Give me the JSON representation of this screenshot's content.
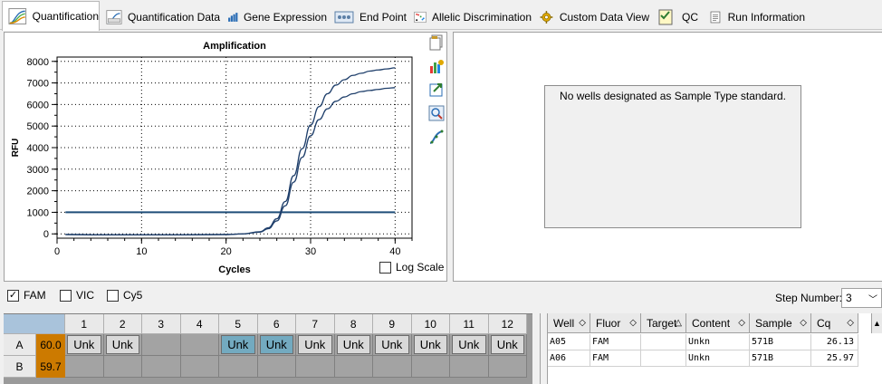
{
  "tabs": [
    {
      "label": "Quantification",
      "icon": "amplification-curve-icon",
      "active": true
    },
    {
      "label": "Quantification Data",
      "icon": "quantification-data-icon",
      "active": false
    },
    {
      "label": "Gene Expression",
      "icon": "bar-chart-icon",
      "active": false
    },
    {
      "label": "End Point",
      "icon": "end-point-icon",
      "active": false
    },
    {
      "label": "Allelic Discrimination",
      "icon": "allelic-scatter-icon",
      "active": false
    },
    {
      "label": "Custom Data View",
      "icon": "gear-icon",
      "active": false
    },
    {
      "label": "QC",
      "icon": "qc-checklist-icon",
      "active": false
    },
    {
      "label": "Run Information",
      "icon": "document-icon",
      "active": false
    }
  ],
  "chart_data": {
    "type": "line",
    "title": "Amplification",
    "xlabel": "Cycles",
    "ylabel": "RFU",
    "xlim": [
      0,
      42
    ],
    "ylim": [
      -200,
      8200
    ],
    "xticks": [
      0,
      10,
      20,
      30,
      40
    ],
    "yticks": [
      0,
      1000,
      2000,
      3000,
      4000,
      5000,
      6000,
      7000,
      8000
    ],
    "grid": true,
    "x": [
      1,
      5,
      10,
      15,
      20,
      22,
      24,
      25,
      26,
      27,
      28,
      29,
      30,
      31,
      32,
      33,
      34,
      35,
      36,
      37,
      38,
      39,
      40
    ],
    "series": [
      {
        "values": [
          -30,
          -40,
          -40,
          -40,
          -30,
          0,
          100,
          280,
          700,
          1500,
          2700,
          3950,
          5050,
          5900,
          6500,
          6900,
          7150,
          7350,
          7450,
          7550,
          7600,
          7650,
          7700
        ]
      },
      {
        "values": [
          -30,
          -40,
          -40,
          -40,
          -30,
          0,
          80,
          240,
          600,
          1300,
          2400,
          3550,
          4550,
          5300,
          5800,
          6150,
          6350,
          6500,
          6600,
          6650,
          6700,
          6750,
          6780
        ]
      }
    ],
    "threshold": 1000
  },
  "chart": {
    "log_scale_label": "Log Scale",
    "log_scale_checked": false,
    "line_color": "#1f3f6b",
    "threshold_color": "#1f4e79"
  },
  "side_tools": [
    "copy-icon",
    "chart-options-icon",
    "export-icon",
    "zoom-icon",
    "curve-tool-icon"
  ],
  "standard_panel": {
    "message": "No wells designated as Sample Type standard."
  },
  "fluors": [
    {
      "label": "FAM",
      "checked": true
    },
    {
      "label": "VIC",
      "checked": false
    },
    {
      "label": "Cy5",
      "checked": false
    }
  ],
  "step": {
    "label": "Step Number:",
    "value": "3"
  },
  "plate": {
    "columns": [
      "1",
      "2",
      "3",
      "4",
      "5",
      "6",
      "7",
      "8",
      "9",
      "10",
      "11",
      "12"
    ],
    "rows": [
      {
        "label": "A",
        "temp": "60.0",
        "wells": [
          "Unk",
          "Unk",
          "",
          "",
          "Unk",
          "Unk",
          "Unk",
          "Unk",
          "Unk",
          "Unk",
          "Unk",
          "Unk"
        ],
        "selected": [
          false,
          false,
          false,
          false,
          true,
          true,
          false,
          false,
          false,
          false,
          false,
          false
        ]
      },
      {
        "label": "B",
        "temp": "59.7",
        "wells": [
          "",
          "",
          "",
          "",
          "",
          "",
          "",
          "",
          "",
          "",
          "",
          ""
        ],
        "selected": [
          false,
          false,
          false,
          false,
          false,
          false,
          false,
          false,
          false,
          false,
          false,
          false
        ]
      }
    ],
    "temp_color": "#cc7a00",
    "selected_color": "#73aac0"
  },
  "results": {
    "headers": [
      "Well",
      "Fluor",
      "Target",
      "Content",
      "Sample",
      "Cq"
    ],
    "rows": [
      [
        "A05",
        "FAM",
        "",
        "Unkn",
        "571B",
        "26.13"
      ],
      [
        "A06",
        "FAM",
        "",
        "Unkn",
        "571B",
        "25.97"
      ]
    ]
  }
}
